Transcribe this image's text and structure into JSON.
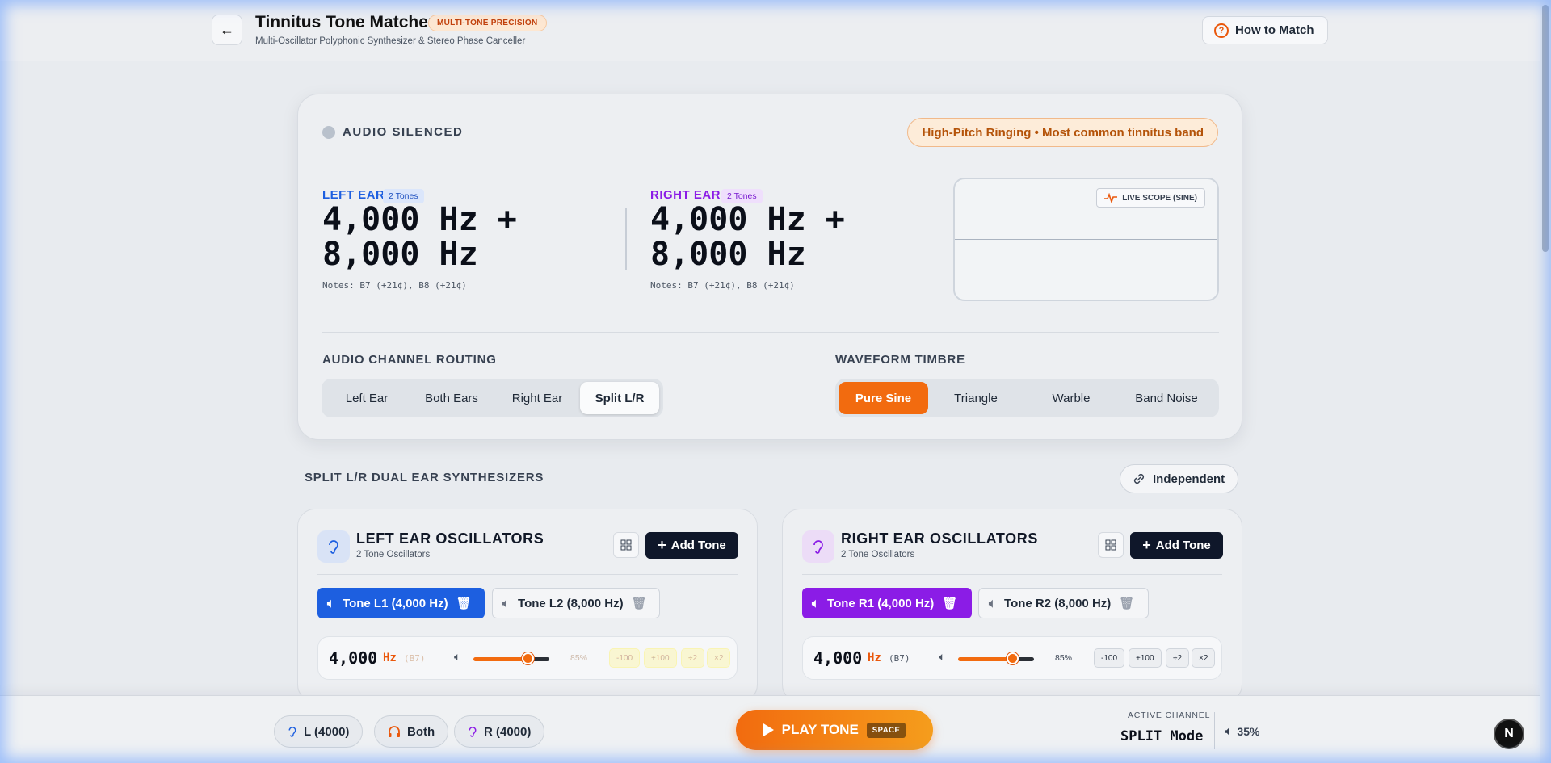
{
  "header": {
    "title": "Tinnitus Tone Matcher",
    "badge": "MULTI-TONE PRECISION",
    "subtitle": "Multi-Oscillator Polyphonic Synthesizer & Stereo Phase Canceller",
    "how_to": "How to Match"
  },
  "status": {
    "label": "AUDIO SILENCED",
    "band": "High-Pitch Ringing • Most common tinnitus band"
  },
  "left_ear": {
    "label": "LEFT EAR",
    "badge": "2 Tones",
    "freq": "4,000 Hz + 8,000 Hz",
    "notes": "Notes: B7 (+21¢), B8 (+21¢)"
  },
  "right_ear": {
    "label": "RIGHT EAR",
    "badge": "2 Tones",
    "freq": "4,000 Hz + 8,000 Hz",
    "notes": "Notes: B7 (+21¢), B8 (+21¢)"
  },
  "scope": {
    "label": "LIVE SCOPE (SINE)"
  },
  "routing": {
    "label": "AUDIO CHANNEL ROUTING",
    "options": [
      "Left Ear",
      "Both Ears",
      "Right Ear",
      "Split L/R"
    ],
    "selected": "Split L/R"
  },
  "timbre": {
    "label": "WAVEFORM TIMBRE",
    "options": [
      "Pure Sine",
      "Triangle",
      "Warble",
      "Band Noise"
    ],
    "selected": "Pure Sine"
  },
  "synth": {
    "title": "SPLIT L/R DUAL EAR SYNTHESIZERS",
    "independent": "Independent"
  },
  "left_osc": {
    "title": "LEFT EAR OSCILLATORS",
    "subtitle": "2 Tone Oscillators",
    "add": "Add Tone",
    "tabs": [
      "Tone L1 (4,000 Hz)",
      "Tone L2 (8,000 Hz)"
    ],
    "row": {
      "freq": "4,000",
      "unit": "Hz",
      "note": "(B7)",
      "volume_pct": "85%",
      "volume": 0.85,
      "buttons": [
        "-100",
        "+100",
        "÷2",
        "×2"
      ]
    }
  },
  "right_osc": {
    "title": "RIGHT EAR OSCILLATORS",
    "subtitle": "2 Tone Oscillators",
    "add": "Add Tone",
    "tabs": [
      "Tone R1 (4,000 Hz)",
      "Tone R2 (8,000 Hz)"
    ],
    "row": {
      "freq": "4,000",
      "unit": "Hz",
      "note": "(B7)",
      "volume_pct": "85%",
      "volume": 0.85,
      "buttons": [
        "-100",
        "+100",
        "÷2",
        "×2"
      ]
    }
  },
  "bottom": {
    "chip_left": "L (4000)",
    "chip_both": "Both",
    "chip_right": "R (4000)",
    "play": "PLAY TONE",
    "play_key": "SPACE",
    "active_label": "ACTIVE CHANNEL",
    "active_mode": "SPLIT Mode",
    "master_volume": "35%"
  },
  "colors": {
    "accent": "#f26b0f",
    "left": "#1d5fe0",
    "right": "#8b1ce6",
    "dark": "#0f172a"
  }
}
